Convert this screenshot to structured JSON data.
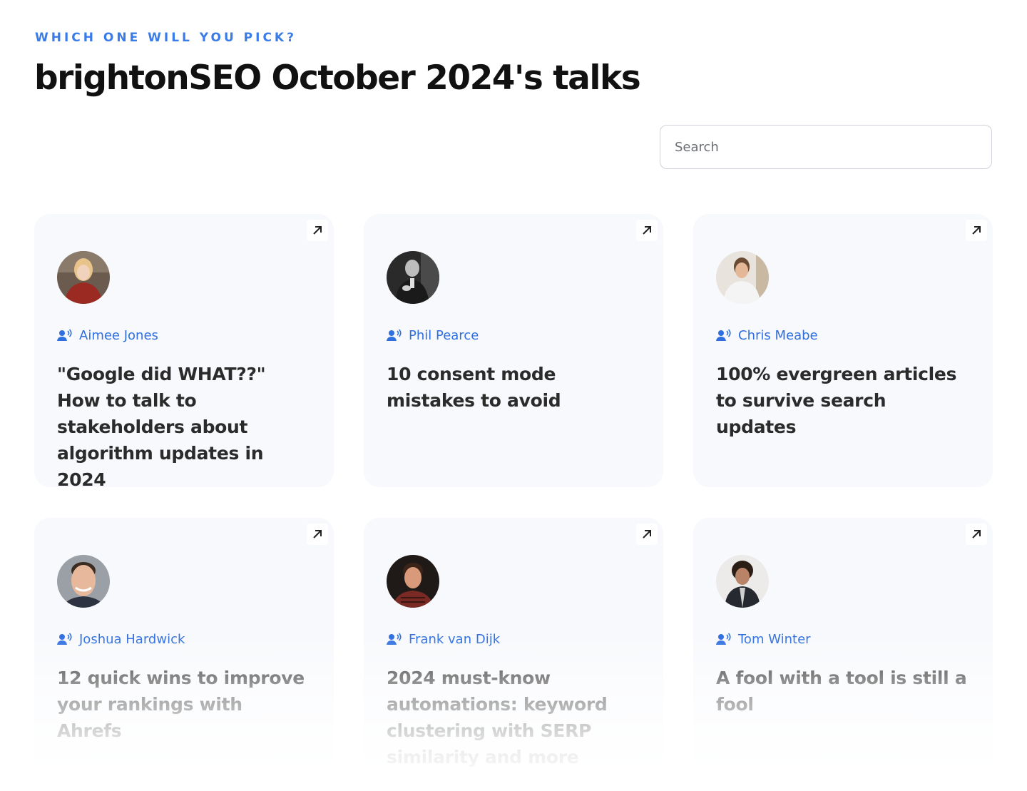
{
  "header": {
    "eyebrow": "WHICH ONE WILL YOU PICK?",
    "title": "brightonSEO October 2024's talks"
  },
  "search": {
    "placeholder": "Search",
    "value": ""
  },
  "colors": {
    "accent": "#3a7bea",
    "speaker_link": "#2f6fe0",
    "card_background": "#f7f9fc"
  },
  "icons": {
    "open": "arrow-up-right-icon",
    "speaker": "speaker-icon"
  },
  "talks": [
    {
      "speaker": "Aimee Jones",
      "title": "\"Google did WHAT??\" How to talk to stakeholders about algorithm updates in 2024"
    },
    {
      "speaker": "Phil Pearce",
      "title": "10 consent mode mistakes to avoid"
    },
    {
      "speaker": "Chris Meabe",
      "title": "100% evergreen articles to survive search updates"
    },
    {
      "speaker": "Joshua Hardwick",
      "title": "12 quick wins to improve your rankings with Ahrefs"
    },
    {
      "speaker": "Frank van Dijk",
      "title": "2024 must-know automations: keyword clustering with SERP similarity and more"
    },
    {
      "speaker": "Tom Winter",
      "title": "A fool with a tool is still a fool"
    }
  ]
}
